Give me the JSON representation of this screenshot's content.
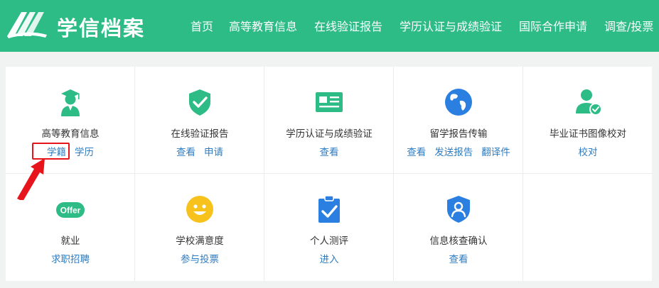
{
  "header": {
    "logo_text": "学信档案",
    "nav": [
      "首页",
      "高等教育信息",
      "在线验证报告",
      "学历认证与成绩验证",
      "国际合作申请",
      "调查/投票"
    ]
  },
  "cards": [
    {
      "title": "高等教育信息",
      "links": [
        "学籍",
        "学历"
      ],
      "icon": "graduate-icon"
    },
    {
      "title": "在线验证报告",
      "links": [
        "查看",
        "申请"
      ],
      "icon": "shield-check-icon"
    },
    {
      "title": "学历认证与成绩验证",
      "links": [
        "查看"
      ],
      "icon": "id-card-icon"
    },
    {
      "title": "留学报告传输",
      "links": [
        "查看",
        "发送报告",
        "翻译件"
      ],
      "icon": "globe-icon"
    },
    {
      "title": "毕业证书图像校对",
      "links": [
        "校对"
      ],
      "icon": "user-check-icon"
    },
    {
      "title": "就业",
      "links": [
        "求职招聘"
      ],
      "icon": "offer-icon",
      "badge": "Offer"
    },
    {
      "title": "学校满意度",
      "links": [
        "参与投票"
      ],
      "icon": "smiley-icon"
    },
    {
      "title": "个人测评",
      "links": [
        "进入"
      ],
      "icon": "clipboard-check-icon"
    },
    {
      "title": "信息核查确认",
      "links": [
        "查看"
      ],
      "icon": "shield-user-icon"
    }
  ],
  "colors": {
    "brand_green": "#2dbb86",
    "link_blue": "#2f7dc0",
    "icon_blue": "#2b7fe0",
    "icon_yellow": "#f6c21b",
    "highlight_red": "#e8141c"
  }
}
